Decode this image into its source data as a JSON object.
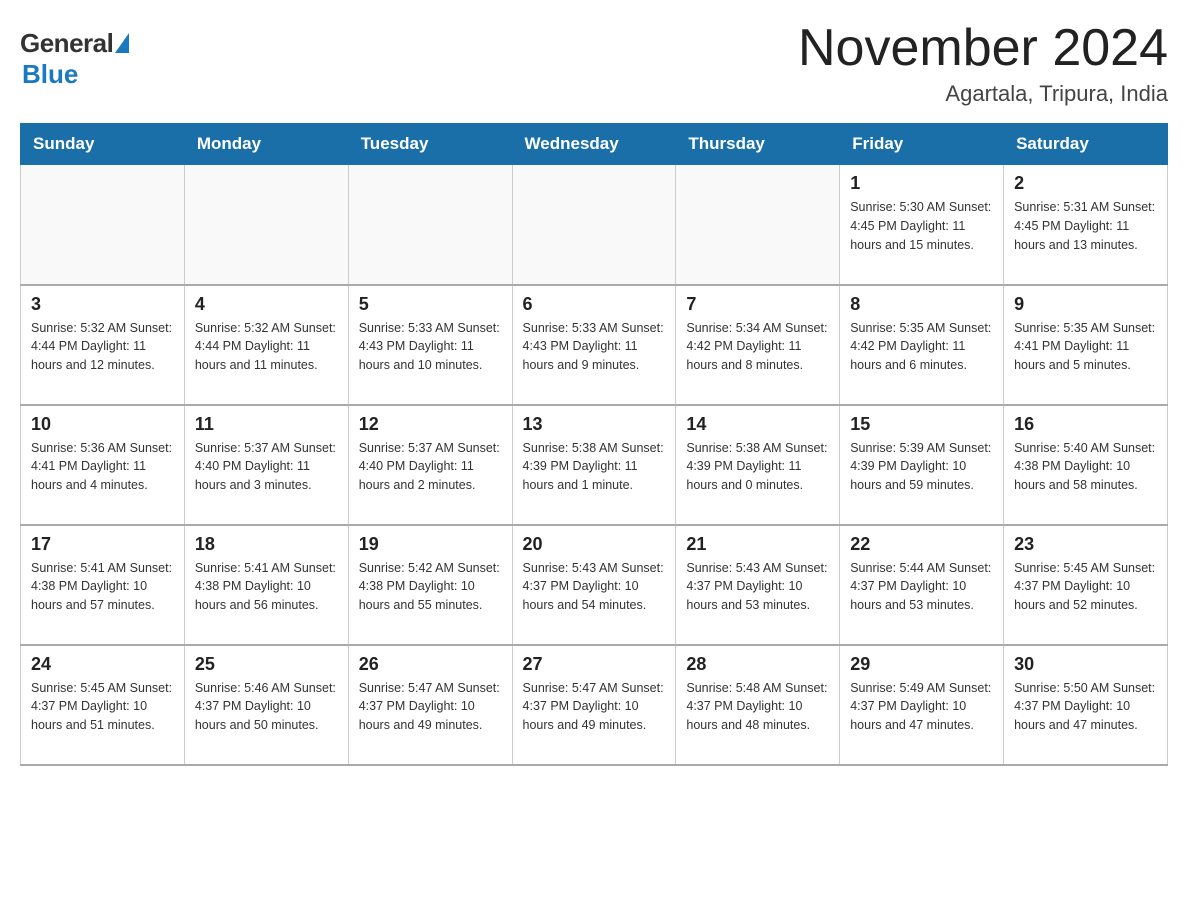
{
  "header": {
    "logo_general": "General",
    "logo_blue": "Blue",
    "month_title": "November 2024",
    "location": "Agartala, Tripura, India"
  },
  "days_of_week": [
    "Sunday",
    "Monday",
    "Tuesday",
    "Wednesday",
    "Thursday",
    "Friday",
    "Saturday"
  ],
  "weeks": [
    {
      "days": [
        {
          "number": "",
          "info": ""
        },
        {
          "number": "",
          "info": ""
        },
        {
          "number": "",
          "info": ""
        },
        {
          "number": "",
          "info": ""
        },
        {
          "number": "",
          "info": ""
        },
        {
          "number": "1",
          "info": "Sunrise: 5:30 AM\nSunset: 4:45 PM\nDaylight: 11 hours\nand 15 minutes."
        },
        {
          "number": "2",
          "info": "Sunrise: 5:31 AM\nSunset: 4:45 PM\nDaylight: 11 hours\nand 13 minutes."
        }
      ]
    },
    {
      "days": [
        {
          "number": "3",
          "info": "Sunrise: 5:32 AM\nSunset: 4:44 PM\nDaylight: 11 hours\nand 12 minutes."
        },
        {
          "number": "4",
          "info": "Sunrise: 5:32 AM\nSunset: 4:44 PM\nDaylight: 11 hours\nand 11 minutes."
        },
        {
          "number": "5",
          "info": "Sunrise: 5:33 AM\nSunset: 4:43 PM\nDaylight: 11 hours\nand 10 minutes."
        },
        {
          "number": "6",
          "info": "Sunrise: 5:33 AM\nSunset: 4:43 PM\nDaylight: 11 hours\nand 9 minutes."
        },
        {
          "number": "7",
          "info": "Sunrise: 5:34 AM\nSunset: 4:42 PM\nDaylight: 11 hours\nand 8 minutes."
        },
        {
          "number": "8",
          "info": "Sunrise: 5:35 AM\nSunset: 4:42 PM\nDaylight: 11 hours\nand 6 minutes."
        },
        {
          "number": "9",
          "info": "Sunrise: 5:35 AM\nSunset: 4:41 PM\nDaylight: 11 hours\nand 5 minutes."
        }
      ]
    },
    {
      "days": [
        {
          "number": "10",
          "info": "Sunrise: 5:36 AM\nSunset: 4:41 PM\nDaylight: 11 hours\nand 4 minutes."
        },
        {
          "number": "11",
          "info": "Sunrise: 5:37 AM\nSunset: 4:40 PM\nDaylight: 11 hours\nand 3 minutes."
        },
        {
          "number": "12",
          "info": "Sunrise: 5:37 AM\nSunset: 4:40 PM\nDaylight: 11 hours\nand 2 minutes."
        },
        {
          "number": "13",
          "info": "Sunrise: 5:38 AM\nSunset: 4:39 PM\nDaylight: 11 hours\nand 1 minute."
        },
        {
          "number": "14",
          "info": "Sunrise: 5:38 AM\nSunset: 4:39 PM\nDaylight: 11 hours\nand 0 minutes."
        },
        {
          "number": "15",
          "info": "Sunrise: 5:39 AM\nSunset: 4:39 PM\nDaylight: 10 hours\nand 59 minutes."
        },
        {
          "number": "16",
          "info": "Sunrise: 5:40 AM\nSunset: 4:38 PM\nDaylight: 10 hours\nand 58 minutes."
        }
      ]
    },
    {
      "days": [
        {
          "number": "17",
          "info": "Sunrise: 5:41 AM\nSunset: 4:38 PM\nDaylight: 10 hours\nand 57 minutes."
        },
        {
          "number": "18",
          "info": "Sunrise: 5:41 AM\nSunset: 4:38 PM\nDaylight: 10 hours\nand 56 minutes."
        },
        {
          "number": "19",
          "info": "Sunrise: 5:42 AM\nSunset: 4:38 PM\nDaylight: 10 hours\nand 55 minutes."
        },
        {
          "number": "20",
          "info": "Sunrise: 5:43 AM\nSunset: 4:37 PM\nDaylight: 10 hours\nand 54 minutes."
        },
        {
          "number": "21",
          "info": "Sunrise: 5:43 AM\nSunset: 4:37 PM\nDaylight: 10 hours\nand 53 minutes."
        },
        {
          "number": "22",
          "info": "Sunrise: 5:44 AM\nSunset: 4:37 PM\nDaylight: 10 hours\nand 53 minutes."
        },
        {
          "number": "23",
          "info": "Sunrise: 5:45 AM\nSunset: 4:37 PM\nDaylight: 10 hours\nand 52 minutes."
        }
      ]
    },
    {
      "days": [
        {
          "number": "24",
          "info": "Sunrise: 5:45 AM\nSunset: 4:37 PM\nDaylight: 10 hours\nand 51 minutes."
        },
        {
          "number": "25",
          "info": "Sunrise: 5:46 AM\nSunset: 4:37 PM\nDaylight: 10 hours\nand 50 minutes."
        },
        {
          "number": "26",
          "info": "Sunrise: 5:47 AM\nSunset: 4:37 PM\nDaylight: 10 hours\nand 49 minutes."
        },
        {
          "number": "27",
          "info": "Sunrise: 5:47 AM\nSunset: 4:37 PM\nDaylight: 10 hours\nand 49 minutes."
        },
        {
          "number": "28",
          "info": "Sunrise: 5:48 AM\nSunset: 4:37 PM\nDaylight: 10 hours\nand 48 minutes."
        },
        {
          "number": "29",
          "info": "Sunrise: 5:49 AM\nSunset: 4:37 PM\nDaylight: 10 hours\nand 47 minutes."
        },
        {
          "number": "30",
          "info": "Sunrise: 5:50 AM\nSunset: 4:37 PM\nDaylight: 10 hours\nand 47 minutes."
        }
      ]
    }
  ]
}
